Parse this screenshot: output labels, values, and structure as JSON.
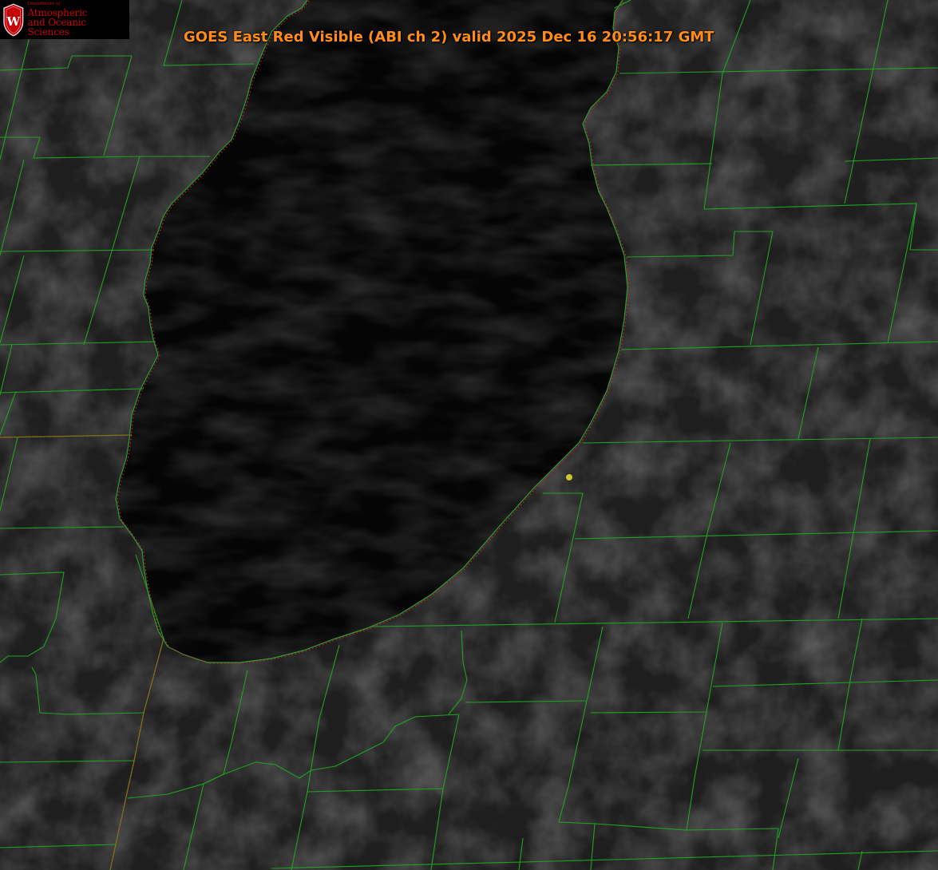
{
  "header": {
    "title": "GOES East Red Visible (ABI ch 2) valid 2025 Dec 16 20:56:17 GMT"
  },
  "logo": {
    "crest_letter": "W",
    "department_label": "Department of",
    "line1": "Atmospheric",
    "line2": "and Oceanic Sciences"
  },
  "map_layers": {
    "land_color": "#1e1e1e",
    "lake_color": "#050505",
    "county_border_color": "#1fa31f",
    "state_border_color": "#b85a14",
    "shoreline_color": "#2f9c2f",
    "lake_outline_dotted_color": "#d0202a",
    "marker_color": "#c9c82a"
  },
  "marker": {
    "name": "station-marker"
  }
}
